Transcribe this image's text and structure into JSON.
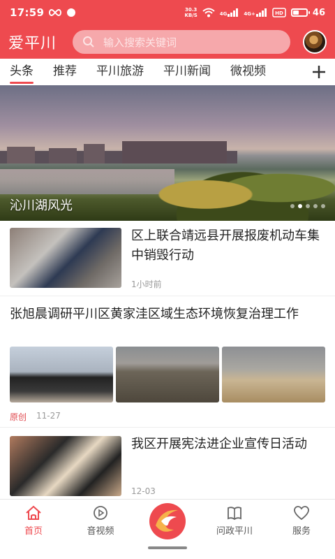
{
  "status": {
    "time": "17:59",
    "speed_value": "30.3",
    "speed_unit": "KB/S",
    "net1": "4G",
    "net2": "4G+",
    "battery": "46",
    "battery_level": 0.46
  },
  "header": {
    "brand": "爱平川",
    "search_placeholder": "输入搜索关键词",
    "colors": {
      "primary": "#ee4a4f",
      "search_bg": "#f6a8ab"
    }
  },
  "tabs": [
    "头条",
    "推荐",
    "平川旅游",
    "平川新闻",
    "微视频"
  ],
  "tabs_add_icon": "plus-icon",
  "banner": {
    "caption": "沁川湖风光",
    "slide_count": 5,
    "active_slide": 2
  },
  "news": [
    {
      "title": "区上联合靖远县开展报废机动车集中销毁行动",
      "time": "1小时前"
    },
    {
      "title": "张旭晨调研平川区黄家洼区域生态环境恢复治理工作",
      "source": "原创",
      "date": "11-27"
    },
    {
      "title": "我区开展宪法进企业宣传日活动",
      "date": "12-03"
    }
  ],
  "bottom_nav": {
    "home": "首页",
    "av": "音视频",
    "ask": "问政平川",
    "service": "服务"
  }
}
